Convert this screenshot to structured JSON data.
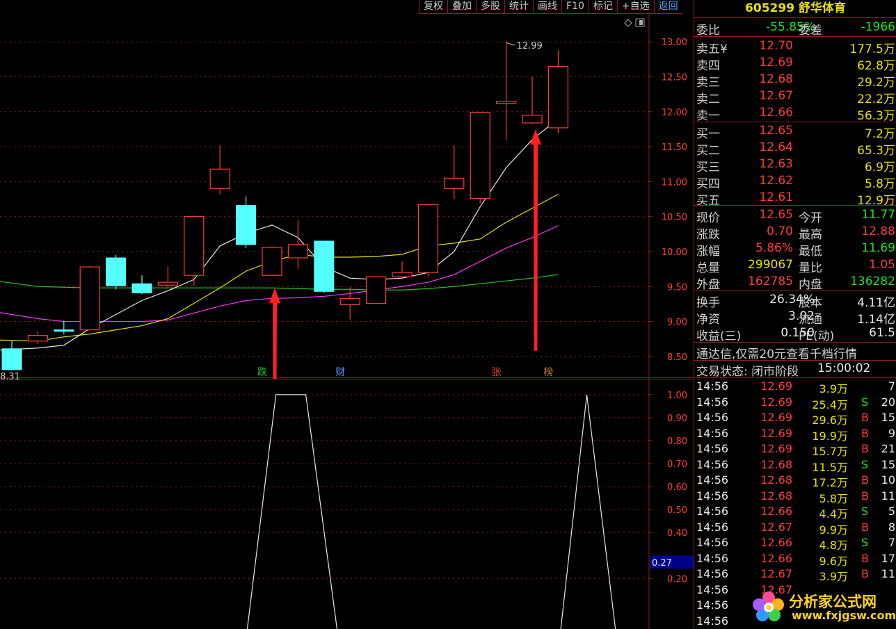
{
  "toolbar": {
    "buttons": [
      "复权",
      "叠加",
      "多股",
      "统计",
      "画线",
      "F10",
      "标记",
      "+自选",
      "返回"
    ]
  },
  "chart_data": [
    {
      "type": "candlestick",
      "title": "",
      "y_ticks": [
        "13.00",
        "12.50",
        "12.00",
        "11.50",
        "11.00",
        "10.50",
        "10.00",
        "9.50",
        "9.00",
        "8.50"
      ],
      "ylim": [
        8.2,
        13.4
      ],
      "candles": [
        {
          "o": 8.61,
          "c": 8.31,
          "h": 8.72,
          "l": 8.3
        },
        {
          "o": 8.72,
          "c": 8.8,
          "h": 8.86,
          "l": 8.68
        },
        {
          "o": 8.88,
          "c": 8.86,
          "h": 9.01,
          "l": 8.82
        },
        {
          "o": 8.88,
          "c": 9.78,
          "h": 9.8,
          "l": 8.87
        },
        {
          "o": 9.91,
          "c": 9.51,
          "h": 9.95,
          "l": 9.46
        },
        {
          "o": 9.54,
          "c": 9.41,
          "h": 9.66,
          "l": 9.39
        },
        {
          "o": 9.52,
          "c": 9.56,
          "h": 9.79,
          "l": 9.49
        },
        {
          "o": 9.66,
          "c": 10.5,
          "h": 10.5,
          "l": 9.51
        },
        {
          "o": 10.9,
          "c": 11.18,
          "h": 11.52,
          "l": 10.82
        },
        {
          "o": 10.66,
          "c": 10.1,
          "h": 10.79,
          "l": 10.05
        },
        {
          "o": 9.66,
          "c": 10.06,
          "h": 10.07,
          "l": 9.65
        },
        {
          "o": 9.91,
          "c": 10.1,
          "h": 10.45,
          "l": 9.75
        },
        {
          "o": 10.15,
          "c": 9.43,
          "h": 10.15,
          "l": 9.41
        },
        {
          "o": 9.24,
          "c": 9.33,
          "h": 9.49,
          "l": 9.03
        },
        {
          "o": 9.26,
          "c": 9.64,
          "h": 9.65,
          "l": 9.26
        },
        {
          "o": 9.64,
          "c": 9.7,
          "h": 9.86,
          "l": 9.63
        },
        {
          "o": 9.7,
          "c": 10.67,
          "h": 10.67,
          "l": 9.64
        },
        {
          "o": 10.9,
          "c": 11.05,
          "h": 11.52,
          "l": 10.75
        },
        {
          "o": 10.76,
          "c": 11.99,
          "h": 11.99,
          "l": 10.69
        },
        {
          "o": 12.12,
          "c": 12.15,
          "h": 12.99,
          "l": 11.6
        },
        {
          "o": 11.84,
          "c": 11.95,
          "h": 12.5,
          "l": 11.82
        },
        {
          "o": 11.77,
          "c": 12.65,
          "h": 12.88,
          "l": 11.69
        }
      ],
      "ma_white": [
        8.6,
        8.62,
        8.66,
        8.9,
        9.1,
        9.3,
        9.44,
        9.6,
        10.08,
        10.26,
        10.38,
        10.2,
        9.78,
        9.62,
        9.6,
        9.62,
        9.7,
        10.0,
        10.64,
        11.2,
        11.6,
        11.9
      ],
      "ma_yellow": [
        8.73,
        8.72,
        8.78,
        8.82,
        8.88,
        8.94,
        9.04,
        9.26,
        9.48,
        9.72,
        9.86,
        9.96,
        9.92,
        9.92,
        9.93,
        9.96,
        10.08,
        10.12,
        10.18,
        10.42,
        10.62,
        10.82
      ],
      "ma_magenta": [
        9.1,
        9.04,
        9.0,
        9.0,
        9.0,
        9.0,
        9.02,
        9.12,
        9.22,
        9.3,
        9.33,
        9.34,
        9.36,
        9.4,
        9.45,
        9.5,
        9.56,
        9.67,
        9.86,
        10.05,
        10.2,
        10.37
      ],
      "ma_green": [
        9.55,
        9.5,
        9.49,
        9.48,
        9.48,
        9.48,
        9.48,
        9.48,
        9.48,
        9.48,
        9.48,
        9.47,
        9.46,
        9.46,
        9.45,
        9.45,
        9.47,
        9.5,
        9.54,
        9.58,
        9.62,
        9.67
      ],
      "high_label": "12.99",
      "low_label": "8.31",
      "event_markers": [
        {
          "index": 10,
          "label": "跌",
          "color": "#21c321"
        },
        {
          "index": 13,
          "label": "财",
          "color": "#5a8fff"
        },
        {
          "index": 19,
          "label": "张",
          "color": "#ff3c3c"
        },
        {
          "index": 21,
          "label": "榜",
          "color": "#c07a3a"
        }
      ],
      "arrows": [
        {
          "x": 11,
          "y_from": 8.18,
          "y_to": 9.48
        },
        {
          "x": 22,
          "y_from": 8.58,
          "y_to": 11.75
        }
      ]
    },
    {
      "type": "line",
      "title": "",
      "y_ticks": [
        "1.00",
        "0.90",
        "0.80",
        "0.70",
        "0.60",
        "0.50",
        "0.40",
        "0.20"
      ],
      "ylim": [
        -0.02,
        1.06
      ],
      "current_value": "0.27",
      "points": [
        {
          "i": 9.05,
          "v": -0.02
        },
        {
          "i": 10.15,
          "v": 1.0
        },
        {
          "i": 11.3,
          "v": 1.0
        },
        {
          "i": 12.5,
          "v": -0.02
        },
        {
          "i": 21.1,
          "v": -0.02
        },
        {
          "i": 22.1,
          "v": 1.0
        },
        {
          "i": 23.2,
          "v": -0.02
        }
      ]
    }
  ],
  "panel": {
    "title": "605299 舒华体育",
    "weibi": {
      "l1": "委比",
      "v1": "-55.85%",
      "l2": "委差",
      "v2": "-1966"
    },
    "sells": [
      {
        "label": "卖五",
        "extra": "¥",
        "price": "12.70",
        "vol": "177.5万"
      },
      {
        "label": "卖四",
        "extra": "",
        "price": "12.69",
        "vol": "62.8万"
      },
      {
        "label": "卖三",
        "extra": "",
        "price": "12.68",
        "vol": "29.2万"
      },
      {
        "label": "卖二",
        "extra": "",
        "price": "12.67",
        "vol": "22.2万"
      },
      {
        "label": "卖一",
        "extra": "",
        "price": "12.66",
        "vol": "56.3万"
      }
    ],
    "buys": [
      {
        "label": "买一",
        "price": "12.65",
        "vol": "7.2万"
      },
      {
        "label": "买二",
        "price": "12.64",
        "vol": "65.3万"
      },
      {
        "label": "买三",
        "price": "12.63",
        "vol": "6.9万"
      },
      {
        "label": "买四",
        "price": "12.62",
        "vol": "5.8万"
      },
      {
        "label": "买五",
        "price": "12.61",
        "vol": "12.9万"
      }
    ],
    "stats": [
      {
        "l1": "现价",
        "v1": "12.65",
        "c1": "red",
        "l2": "今开",
        "v2": "11.77",
        "c2": "green"
      },
      {
        "l1": "涨跌",
        "v1": "0.70",
        "c1": "red",
        "l2": "最高",
        "v2": "12.88",
        "c2": "red"
      },
      {
        "l1": "涨幅",
        "v1": "5.86%",
        "c1": "red",
        "l2": "最低",
        "v2": "11.69",
        "c2": "green"
      },
      {
        "l1": "总量",
        "v1": "299067",
        "c1": "yellow",
        "l2": "量比",
        "v2": "1.05",
        "c2": "red"
      },
      {
        "l1": "外盘",
        "v1": "162785",
        "c1": "red",
        "l2": "内盘",
        "v2": "136282",
        "c2": "green"
      }
    ],
    "stats2": [
      {
        "l1": "换手",
        "v1": "26.34%",
        "l2": "股本",
        "v2": "4.11亿"
      },
      {
        "l1": "净资",
        "v1": "3.02",
        "l2": "流通",
        "v2": "1.14亿"
      },
      {
        "l1": "收益(三)",
        "v1": "0.150",
        "l2": "PE(动)",
        "v2": "61.5"
      }
    ],
    "promo": "通达信,仅需20元查看千档行情",
    "trade_status_label": "交易状态: 闭市阶段",
    "trade_status_time": "15:00:02",
    "ticks": [
      {
        "t": "14:56",
        "p": "12.69",
        "v": "3.9万",
        "s": "",
        "n": "7",
        "pc": "red"
      },
      {
        "t": "14:56",
        "p": "12.69",
        "v": "25.4万",
        "s": "S",
        "n": "20",
        "pc": "red"
      },
      {
        "t": "14:56",
        "p": "12.69",
        "v": "29.6万",
        "s": "B",
        "n": "15",
        "pc": "red"
      },
      {
        "t": "14:56",
        "p": "12.69",
        "v": "19.9万",
        "s": "B",
        "n": "9",
        "pc": "red"
      },
      {
        "t": "14:56",
        "p": "12.69",
        "v": "15.7万",
        "s": "B",
        "n": "21",
        "pc": "red"
      },
      {
        "t": "14:56",
        "p": "12.68",
        "v": "11.5万",
        "s": "S",
        "n": "15",
        "pc": "red"
      },
      {
        "t": "14:56",
        "p": "12.68",
        "v": "17.2万",
        "s": "B",
        "n": "10",
        "pc": "red"
      },
      {
        "t": "14:56",
        "p": "12.68",
        "v": "5.8万",
        "s": "B",
        "n": "11",
        "pc": "red"
      },
      {
        "t": "14:56",
        "p": "12.66",
        "v": "4.4万",
        "s": "S",
        "n": "5",
        "pc": "red"
      },
      {
        "t": "14:56",
        "p": "12.67",
        "v": "9.9万",
        "s": "B",
        "n": "8",
        "pc": "red"
      },
      {
        "t": "14:56",
        "p": "12.66",
        "v": "4.8万",
        "s": "S",
        "n": "7",
        "pc": "red"
      },
      {
        "t": "14:56",
        "p": "12.66",
        "v": "9.6万",
        "s": "B",
        "n": "17",
        "pc": "red"
      },
      {
        "t": "14:56",
        "p": "12.67",
        "v": "3.9万",
        "s": "B",
        "n": "11",
        "pc": "red"
      },
      {
        "t": "14:56",
        "p": "12.67",
        "v": "",
        "s": "",
        "n": "",
        "pc": "red"
      },
      {
        "t": "14:56",
        "p": "",
        "v": "",
        "s": "",
        "n": "",
        "pc": "red"
      },
      {
        "t": "14:56",
        "p": "",
        "v": "",
        "s": "",
        "n": "",
        "pc": "red"
      }
    ]
  },
  "watermark": {
    "line1": "分析家公式网",
    "line2": "www.fxjgsw.com"
  },
  "colors": {
    "up": "#ff3c3c",
    "down": "#54ffff",
    "grid": "#8c1f1f",
    "axis_text": "#ff3c3c"
  }
}
